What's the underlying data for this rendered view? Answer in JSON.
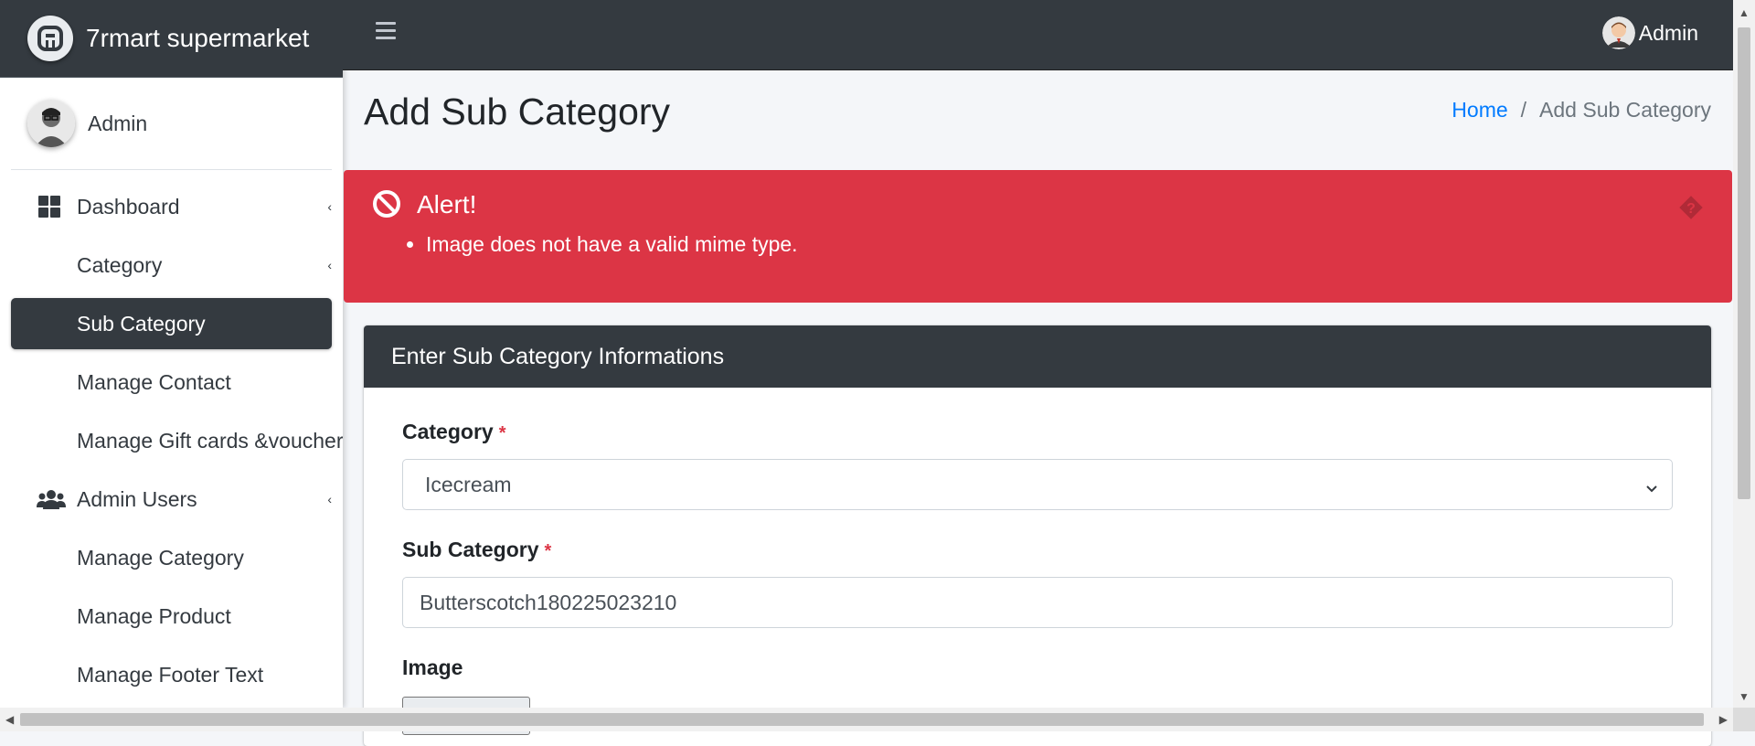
{
  "brand": {
    "name": "7rmart supermarket"
  },
  "sidebar": {
    "user_name": "Admin",
    "items": [
      {
        "label": "Dashboard",
        "icon": "dashboard-icon",
        "caret": "‹"
      },
      {
        "label": "Category",
        "caret": "‹"
      },
      {
        "label": "Sub Category",
        "active": true
      },
      {
        "label": "Manage Contact"
      },
      {
        "label": "Manage Gift cards &voucher"
      },
      {
        "label": "Admin Users",
        "icon": "users-icon",
        "caret": "‹"
      },
      {
        "label": "Manage Category"
      },
      {
        "label": "Manage Product"
      },
      {
        "label": "Manage Footer Text"
      }
    ]
  },
  "topbar": {
    "user_name": "Admin"
  },
  "page": {
    "title": "Add Sub Category",
    "breadcrumb": {
      "home": "Home",
      "separator": "/",
      "current": "Add Sub Category"
    }
  },
  "alert": {
    "title": "Alert!",
    "messages": [
      "Image does not have a valid mime type."
    ],
    "color": "#dc3545"
  },
  "form": {
    "header": "Enter Sub Category Informations",
    "category_label": "Category",
    "category_value": "Icecream",
    "subcategory_label": "Sub Category",
    "subcategory_value": "Butterscotch180225023210",
    "image_label": "Image",
    "required_mark": "*"
  },
  "colors": {
    "dark": "#343a40",
    "link": "#007bff",
    "danger": "#dc3545"
  }
}
